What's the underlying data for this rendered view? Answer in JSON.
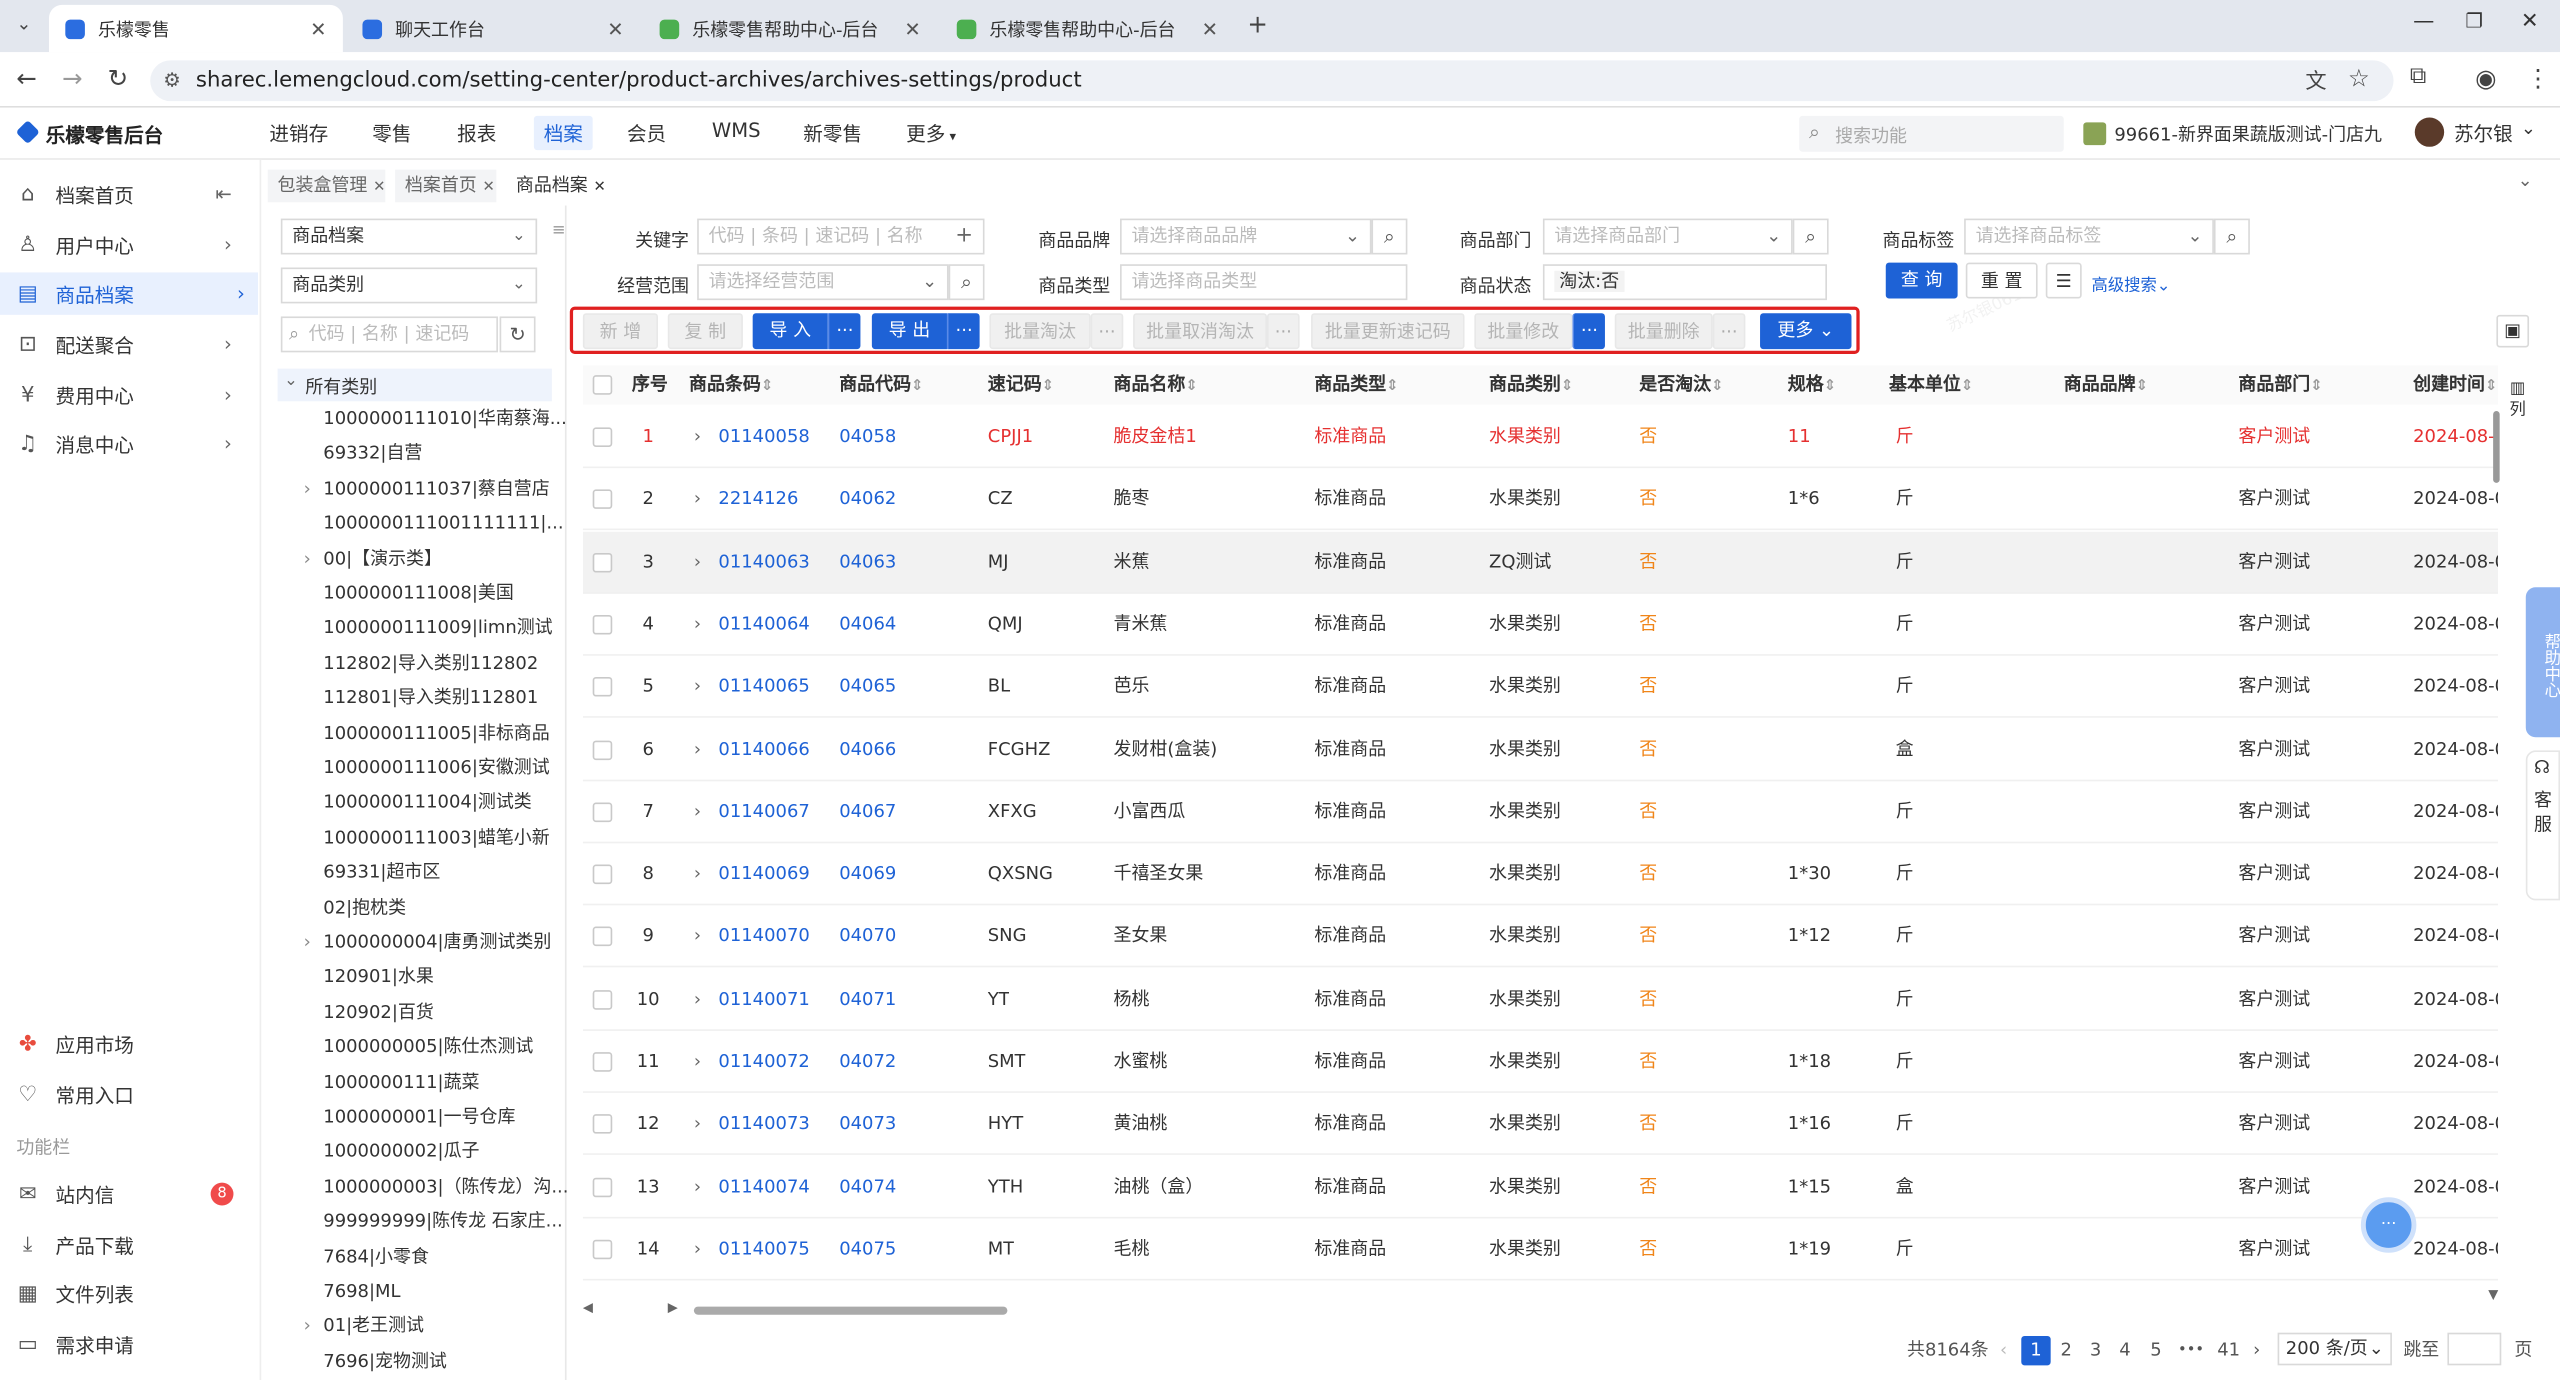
{
  "browser": {
    "tabs": [
      {
        "label": "乐檬零售",
        "active": true
      },
      {
        "label": "聊天工作台",
        "active": false
      },
      {
        "label": "乐檬零售帮助中心-后台",
        "active": false
      },
      {
        "label": "乐檬零售帮助中心-后台",
        "active": false
      }
    ],
    "new_tab": "+",
    "url": "sharec.lemengcloud.com/setting-center/product-archives/archives-settings/product"
  },
  "app": {
    "logo": "乐檬零售后台",
    "top_nav": [
      "进销存",
      "零售",
      "报表",
      "档案",
      "会员",
      "WMS",
      "新零售",
      "更多"
    ],
    "active_nav": "档案",
    "search_placeholder": "搜索功能",
    "store": "99661-新界面果蔬版测试-门店九",
    "user": "苏尔银"
  },
  "sidebar": {
    "items": [
      {
        "label": "档案首页",
        "icon": "home-icon"
      },
      {
        "label": "用户中心",
        "icon": "user-icon"
      },
      {
        "label": "商品档案",
        "icon": "product-icon",
        "active": true
      },
      {
        "label": "配送聚合",
        "icon": "delivery-icon"
      },
      {
        "label": "费用中心",
        "icon": "fee-icon"
      },
      {
        "label": "消息中心",
        "icon": "bell-icon"
      }
    ],
    "bottom_items": [
      {
        "label": "应用市场",
        "icon": "app-market-icon"
      },
      {
        "label": "常用入口",
        "icon": "heart-icon"
      }
    ],
    "section_label": "功能栏",
    "tools": [
      {
        "label": "站内信",
        "icon": "mail-icon",
        "badge": "8"
      },
      {
        "label": "产品下载",
        "icon": "download-icon"
      },
      {
        "label": "文件列表",
        "icon": "file-list-icon"
      },
      {
        "label": "需求申请",
        "icon": "request-icon"
      }
    ]
  },
  "page_tabs": [
    "包装盒管理",
    "档案首页",
    "商品档案"
  ],
  "tree": {
    "select1": "商品档案",
    "select2": "商品类别",
    "search_placeholder": "代码 | 名称 | 速记码",
    "root": "所有类别",
    "nodes": [
      {
        "label": "1000000111010|华南蔡海...",
        "expandable": false
      },
      {
        "label": "69332|自营",
        "expandable": false
      },
      {
        "label": "1000000111037|蔡自营店",
        "expandable": true
      },
      {
        "label": "1000000111001111111|...",
        "expandable": false
      },
      {
        "label": "00|【演示类】",
        "expandable": true
      },
      {
        "label": "1000000111008|美国",
        "expandable": false
      },
      {
        "label": "1000000111009|limn测试",
        "expandable": false
      },
      {
        "label": "112802|导入类别112802",
        "expandable": false
      },
      {
        "label": "112801|导入类别112801",
        "expandable": false
      },
      {
        "label": "1000000111005|非标商品",
        "expandable": false
      },
      {
        "label": "1000000111006|安徽测试",
        "expandable": false
      },
      {
        "label": "1000000111004|测试类",
        "expandable": false
      },
      {
        "label": "1000000111003|蜡笔小新",
        "expandable": false
      },
      {
        "label": "69331|超市区",
        "expandable": false
      },
      {
        "label": "02|抱枕类",
        "expandable": false
      },
      {
        "label": "1000000004|唐勇测试类别",
        "expandable": true
      },
      {
        "label": "120901|水果",
        "expandable": false
      },
      {
        "label": "120902|百货",
        "expandable": false
      },
      {
        "label": "1000000005|陈仕杰测试",
        "expandable": false
      },
      {
        "label": "1000000111|蔬菜",
        "expandable": false
      },
      {
        "label": "1000000001|一号仓库",
        "expandable": false
      },
      {
        "label": "1000000002|瓜子",
        "expandable": false
      },
      {
        "label": "1000000003|（陈传龙）沟...",
        "expandable": false
      },
      {
        "label": "999999999|陈传龙 石家庄...",
        "expandable": false
      },
      {
        "label": "7684|小零食",
        "expandable": false
      },
      {
        "label": "7698|ML",
        "expandable": false
      },
      {
        "label": "01|老王测试",
        "expandable": true
      },
      {
        "label": "7696|宠物测试",
        "expandable": false
      }
    ]
  },
  "filters": {
    "keyword_label": "关键字",
    "keyword_placeholder": "代码 | 条码 | 速记码 | 名称",
    "brand_label": "商品品牌",
    "brand_placeholder": "请选择商品品牌",
    "dept_label": "商品部门",
    "dept_placeholder": "请选择商品部门",
    "tag_label": "商品标签",
    "tag_placeholder": "请选择商品标签",
    "scope_label": "经营范围",
    "scope_placeholder": "请选择经营范围",
    "type_label": "商品类型",
    "type_placeholder": "请选择商品类型",
    "status_label": "商品状态",
    "status_value": "淘汰:否",
    "query": "查 询",
    "reset": "重 置",
    "advanced": "高级搜索"
  },
  "toolbar": {
    "add": "新 增",
    "copy": "复 制",
    "import": "导 入",
    "export": "导 出",
    "batch_eliminate": "批量淘汰",
    "batch_uneliminate": "批量取消淘汰",
    "batch_update_code": "批量更新速记码",
    "batch_modify": "批量修改",
    "batch_delete": "批量删除",
    "more": "更多",
    "ellipsis": "···"
  },
  "table": {
    "columns": [
      "序号",
      "商品条码",
      "商品代码",
      "速记码",
      "商品名称",
      "商品类型",
      "商品类别",
      "是否淘汰",
      "规格",
      "基本单位",
      "商品品牌",
      "商品部门",
      "创建时间"
    ],
    "column_setting": "列",
    "rows": [
      {
        "no": "1",
        "barcode": "01140058",
        "code": "04058",
        "quick": "CPJJ1",
        "name": "脆皮金桔1",
        "type": "标准商品",
        "category": "水果类别",
        "eliminated": "否",
        "spec": "11",
        "unit": "斤",
        "brand": "",
        "dept": "客户测试",
        "created": "2024-08-0",
        "red": true
      },
      {
        "no": "2",
        "barcode": "2214126",
        "code": "04062",
        "quick": "CZ",
        "name": "脆枣",
        "type": "标准商品",
        "category": "水果类别",
        "eliminated": "否",
        "spec": "1*6",
        "unit": "斤",
        "brand": "",
        "dept": "客户测试",
        "created": "2024-08-0"
      },
      {
        "no": "3",
        "barcode": "01140063",
        "code": "04063",
        "quick": "MJ",
        "name": "米蕉",
        "type": "标准商品",
        "category": "ZQ测试",
        "eliminated": "否",
        "spec": "",
        "unit": "斤",
        "brand": "",
        "dept": "客户测试",
        "created": "2024-08-0",
        "highlight": true
      },
      {
        "no": "4",
        "barcode": "01140064",
        "code": "04064",
        "quick": "QMJ",
        "name": "青米蕉",
        "type": "标准商品",
        "category": "水果类别",
        "eliminated": "否",
        "spec": "",
        "unit": "斤",
        "brand": "",
        "dept": "客户测试",
        "created": "2024-08-0"
      },
      {
        "no": "5",
        "barcode": "01140065",
        "code": "04065",
        "quick": "BL",
        "name": "芭乐",
        "type": "标准商品",
        "category": "水果类别",
        "eliminated": "否",
        "spec": "",
        "unit": "斤",
        "brand": "",
        "dept": "客户测试",
        "created": "2024-08-0"
      },
      {
        "no": "6",
        "barcode": "01140066",
        "code": "04066",
        "quick": "FCGHZ",
        "name": "发财柑(盒装)",
        "type": "标准商品",
        "category": "水果类别",
        "eliminated": "否",
        "spec": "",
        "unit": "盒",
        "brand": "",
        "dept": "客户测试",
        "created": "2024-08-0"
      },
      {
        "no": "7",
        "barcode": "01140067",
        "code": "04067",
        "quick": "XFXG",
        "name": "小富西瓜",
        "type": "标准商品",
        "category": "水果类别",
        "eliminated": "否",
        "spec": "",
        "unit": "斤",
        "brand": "",
        "dept": "客户测试",
        "created": "2024-08-0"
      },
      {
        "no": "8",
        "barcode": "01140069",
        "code": "04069",
        "quick": "QXSNG",
        "name": "千禧圣女果",
        "type": "标准商品",
        "category": "水果类别",
        "eliminated": "否",
        "spec": "1*30",
        "unit": "斤",
        "brand": "",
        "dept": "客户测试",
        "created": "2024-08-0"
      },
      {
        "no": "9",
        "barcode": "01140070",
        "code": "04070",
        "quick": "SNG",
        "name": "圣女果",
        "type": "标准商品",
        "category": "水果类别",
        "eliminated": "否",
        "spec": "1*12",
        "unit": "斤",
        "brand": "",
        "dept": "客户测试",
        "created": "2024-08-0"
      },
      {
        "no": "10",
        "barcode": "01140071",
        "code": "04071",
        "quick": "YT",
        "name": "杨桃",
        "type": "标准商品",
        "category": "水果类别",
        "eliminated": "否",
        "spec": "",
        "unit": "斤",
        "brand": "",
        "dept": "客户测试",
        "created": "2024-08-0"
      },
      {
        "no": "11",
        "barcode": "01140072",
        "code": "04072",
        "quick": "SMT",
        "name": "水蜜桃",
        "type": "标准商品",
        "category": "水果类别",
        "eliminated": "否",
        "spec": "1*18",
        "unit": "斤",
        "brand": "",
        "dept": "客户测试",
        "created": "2024-08-0"
      },
      {
        "no": "12",
        "barcode": "01140073",
        "code": "04073",
        "quick": "HYT",
        "name": "黄油桃",
        "type": "标准商品",
        "category": "水果类别",
        "eliminated": "否",
        "spec": "1*16",
        "unit": "斤",
        "brand": "",
        "dept": "客户测试",
        "created": "2024-08-0"
      },
      {
        "no": "13",
        "barcode": "01140074",
        "code": "04074",
        "quick": "YTH",
        "name": "油桃（盒）",
        "type": "标准商品",
        "category": "水果类别",
        "eliminated": "否",
        "spec": "1*15",
        "unit": "盒",
        "brand": "",
        "dept": "客户测试",
        "created": "2024-08-0"
      },
      {
        "no": "14",
        "barcode": "01140075",
        "code": "04075",
        "quick": "MT",
        "name": "毛桃",
        "type": "标准商品",
        "category": "水果类别",
        "eliminated": "否",
        "spec": "1*19",
        "unit": "斤",
        "brand": "",
        "dept": "客户测试",
        "created": "2024-08-0"
      }
    ]
  },
  "pagination": {
    "total": "共8164条",
    "pages": [
      "1",
      "2",
      "3",
      "4",
      "5",
      "•••",
      "41"
    ],
    "current": "1",
    "page_size": "200 条/页",
    "jump_label": "跳至",
    "page_suffix": "页"
  },
  "float": {
    "help": "帮助中心",
    "service": "客服"
  },
  "colors": {
    "primary": "#1e62d6",
    "red": "#e53030",
    "orange": "#f08519",
    "highlight_box": "#e02020"
  }
}
